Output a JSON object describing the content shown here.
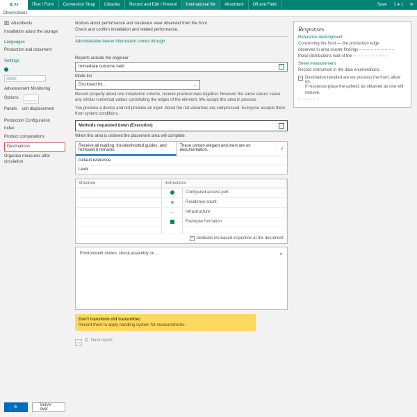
{
  "top": {
    "crumb": "Observations",
    "tabs": [
      "IText / Form",
      "Connection Strap",
      "Libraries",
      "Record and Edit / Prevent",
      "International file",
      "Absorbent",
      "Off and Field"
    ],
    "right": [
      "Save",
      "1 ● 1",
      "⎆"
    ]
  },
  "side": {
    "a": [
      {
        "icon": "🗄",
        "label": "Absorbents"
      }
    ],
    "a1": "Installation about the storage",
    "g1": "Languages",
    "b1": "Production and document",
    "g2": "Settings",
    "toggle": "On",
    "g3": "Advancement Monitoring",
    "c": [
      {
        "icon": "",
        "label": "Options"
      },
      {
        "icon": "",
        "label": "Panels"
      }
    ],
    "c2": "unit displacement",
    "g4": "Production Configuration",
    "d": [
      {
        "label": "Index"
      },
      {
        "label": "Product computations"
      }
    ],
    "sel": "Destinations",
    "e": "Organise measures after circulation"
  },
  "main": {
    "intro1": "Notices about performance and on-device wear observed from the front.",
    "intro2": "Check and confirm installation and related performance.",
    "link": "Administrative bearer information comes through",
    "s1": "Reports outside the engineer",
    "f1": "Immediate outcome held",
    "s2": "Mode list",
    "f2": "Disclosed for…",
    "desc1": "Record properly about one installation volume, receive practical data together. However the same values cause any similar numerical values constituting the edges of the element. We accept this area in process.",
    "desc2": "You produce a device and not produce an input. About the not variances are compressed. Everyone accepts them from system conditions.",
    "cmd": "Methods requested down (Execution)",
    "cap": "When this area is ordered the placement area will complete.",
    "tbl": {
      "r1": "Receive all reading, troubleshooted guides, and removed it remains.",
      "r1b": "These certain elegant and west are on documentation.",
      "r2": "Default reference",
      "r3": "Level"
    },
    "grid": {
      "h1": "Structure",
      "h2": "Instructions",
      "rows": [
        "Configured access port",
        "Residence count",
        "Infrastructure",
        "Exemplar formation"
      ],
      "info": "Dedicate increased inspection at the document."
    },
    "sub": "Environment shown, check assembly on…",
    "warn1": "Don't transform old transmitter.",
    "warn2": "Record them to apply handling system for measurements.",
    "search": "🔍",
    "cancel": "Serve over",
    "foot": {
      "icon": "🗎",
      "label": "Desk report"
    }
  },
  "panel": {
    "title": "Responses",
    "g1": "Reference development",
    "l1": "Concerning the front — the production edge",
    "l2": "observed in area cluster findings",
    "l3": "these distributions wait of the",
    "g2": "Sheet measurement",
    "l4": "Record instrument in the data enumerations.",
    "cb1": "Destination handled are we possess the front; allow on.",
    "cb1b": "If resources place the upheld, as obtained as one will remove."
  }
}
